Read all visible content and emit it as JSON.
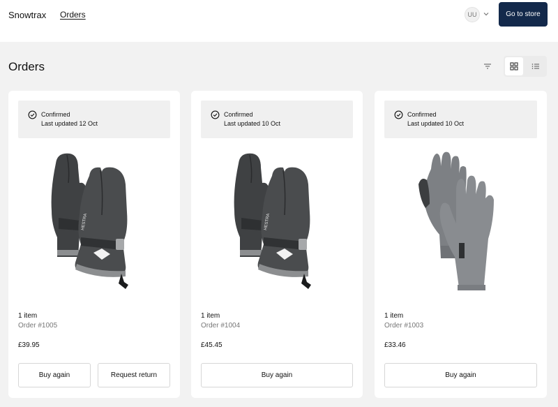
{
  "header": {
    "brand": "Snowtrax",
    "nav_orders": "Orders",
    "avatar_initials": "UU",
    "go_to_store": "Go to store"
  },
  "page": {
    "title": "Orders"
  },
  "orders": [
    {
      "status": "Confirmed",
      "updated": "Last updated 12 Oct",
      "items": "1 item",
      "order_number": "Order #1005",
      "price": "£39.95",
      "buy_again": "Buy again",
      "request_return": "Request return",
      "product_image": "black-mittens"
    },
    {
      "status": "Confirmed",
      "updated": "Last updated 10 Oct",
      "items": "1 item",
      "order_number": "Order #1004",
      "price": "£45.45",
      "buy_again": "Buy again",
      "product_image": "black-mittens"
    },
    {
      "status": "Confirmed",
      "updated": "Last updated 10 Oct",
      "items": "1 item",
      "order_number": "Order #1003",
      "price": "£33.46",
      "buy_again": "Buy again",
      "product_image": "grey-gloves"
    }
  ],
  "colors": {
    "primary_button": "#13294b",
    "page_background": "#f2f2f2",
    "status_background": "#f0f0f0"
  },
  "icons": [
    "check-circle-icon",
    "chevron-down-icon",
    "filter-icon",
    "grid-view-icon",
    "list-view-icon"
  ]
}
